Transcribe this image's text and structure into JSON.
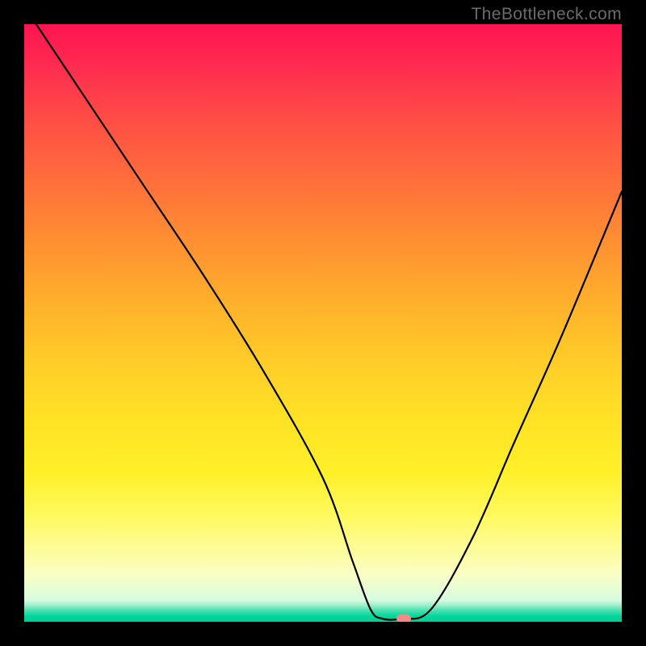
{
  "watermark": "TheBottleneck.com",
  "chart_data": {
    "type": "line",
    "title": "",
    "xlabel": "",
    "ylabel": "",
    "xlim": [
      0,
      100
    ],
    "ylim": [
      0,
      100
    ],
    "curve": {
      "name": "bottleneck-curve",
      "x": [
        2,
        10,
        20,
        30,
        40,
        50,
        55,
        58,
        60,
        63,
        68,
        75,
        82,
        90,
        100
      ],
      "y": [
        100,
        88,
        73,
        58,
        42,
        24,
        10,
        2,
        0.5,
        0.5,
        2,
        14,
        30,
        48,
        72
      ]
    },
    "marker": {
      "x": 63.5,
      "y": 0.5
    },
    "gradient_stops": [
      {
        "pos": 0,
        "color": "#ff1450"
      },
      {
        "pos": 50,
        "color": "#ffc928"
      },
      {
        "pos": 92,
        "color": "#fbfec4"
      },
      {
        "pos": 100,
        "color": "#00cf93"
      }
    ]
  }
}
